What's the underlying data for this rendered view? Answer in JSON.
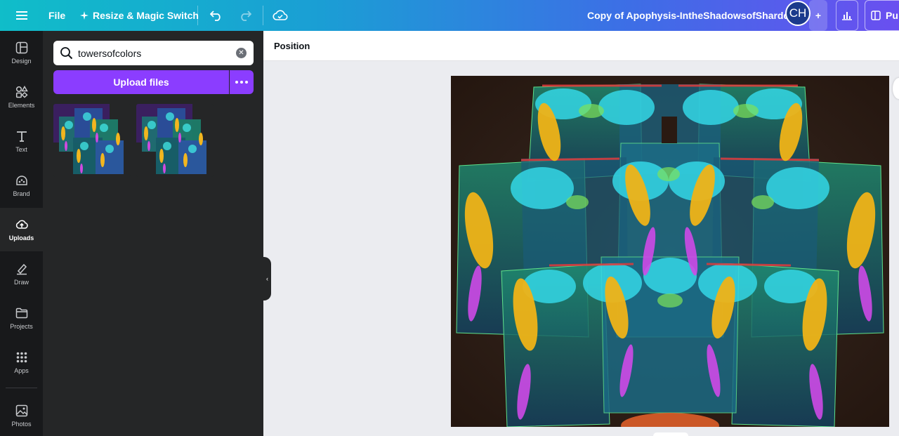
{
  "topbar": {
    "file_label": "File",
    "resize_label": "Resize & Magic Switch",
    "doc_title": "Copy of Apophysis-IntheShadowsofShardds",
    "avatar_initials": "CH",
    "publish_label": "Pu"
  },
  "rail": {
    "items": [
      {
        "label": "Design",
        "icon": "design-icon"
      },
      {
        "label": "Elements",
        "icon": "elements-icon"
      },
      {
        "label": "Text",
        "icon": "text-icon"
      },
      {
        "label": "Brand",
        "icon": "brand-icon"
      },
      {
        "label": "Uploads",
        "icon": "uploads-icon",
        "active": true
      },
      {
        "label": "Draw",
        "icon": "draw-icon"
      },
      {
        "label": "Projects",
        "icon": "projects-icon"
      },
      {
        "label": "Apps",
        "icon": "apps-icon"
      },
      {
        "label": "Photos",
        "icon": "photos-icon"
      }
    ]
  },
  "panel": {
    "search_value": "towersofcolors",
    "upload_label": "Upload files"
  },
  "toolbar": {
    "position_label": "Position"
  },
  "colors": {
    "accent": "#8b3dff",
    "rail_bg": "#18191b",
    "panel_bg": "#252627",
    "canvas_bg": "#ebecf0"
  }
}
